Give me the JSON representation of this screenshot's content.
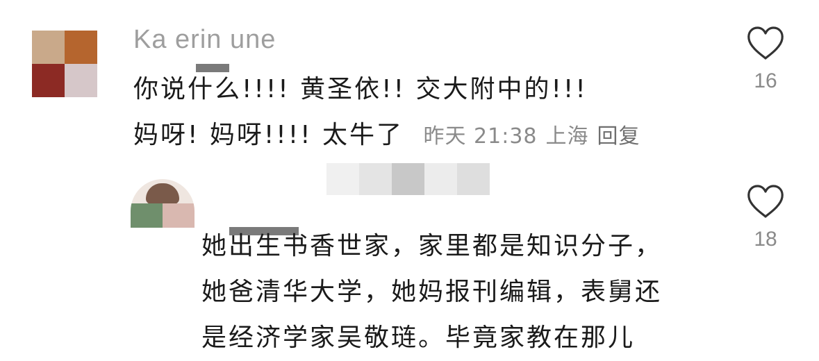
{
  "comments": [
    {
      "username": "Ka  erin    une",
      "text_lines": [
        "你说什么!!!! 黄圣依!! 交大附中的!!!",
        "妈呀! 妈呀!!!! 太牛了"
      ],
      "time": "昨天 21:38",
      "location": "上海",
      "reply_label": "回复",
      "likes": "16"
    },
    {
      "username": "",
      "text_lines": [
        "她出生书香世家，家里都是知识分子，",
        "她爸清华大学，她妈报刊编辑，表舅还",
        "是经济学家吴敬琏。毕竟家教在那儿"
      ],
      "likes": "18"
    }
  ],
  "colors": {
    "text": "#1a1a1a",
    "meta": "#8a8a8a",
    "icon": "#333333"
  },
  "icons": {
    "like": "heart-outline-icon"
  }
}
